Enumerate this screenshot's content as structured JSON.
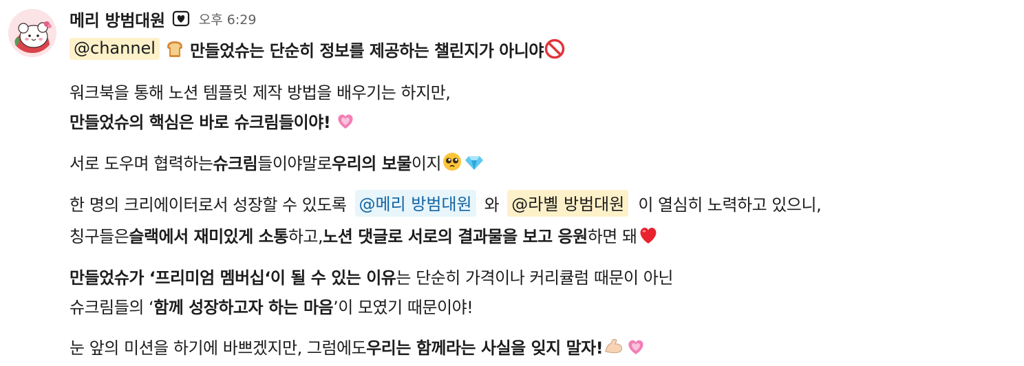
{
  "message": {
    "sender": "메리 방범대원",
    "timestamp": "오후 6:29",
    "status_emoji": "mailbox-heart-emoji",
    "line1": {
      "mention": "@channel",
      "emoji_bread": "bread-emoji",
      "text": "만들었슈는 단순히 정보를 제공하는 챌린지가 아니야",
      "emoji_no": "no-entry-sign-emoji"
    },
    "line2": {
      "text": "워크북을 통해 노션 템플릿 제작 방법을 배우기는 하지만,"
    },
    "line3": {
      "bold": "만들었슈의 핵심은 바로 슈크림들이야!",
      "emoji": "growing-heart-emoji"
    },
    "line4": {
      "t1": "서로 도우며 협력하는 ",
      "b1": "슈크림",
      "t2": "들이야말로 ",
      "b2": "우리의 보물",
      "t3": "이지",
      "emoji1": "pleading-face-emoji",
      "emoji2": "gem-emoji"
    },
    "line5": {
      "t1": "한 명의 크리에이터로서 성장할 수 있도록",
      "mention1": "@메리 방범대원",
      "t2": "와",
      "mention2": "@라볠 방범대원",
      "t3": "이 열심히 노력하고 있으니,"
    },
    "line6": {
      "t1": "칭구들은 ",
      "b1": "슬랙에서 재미있게 소통",
      "t2": "하고, ",
      "b2": "노션 댓글로 서로의 결과물을 보고 응원",
      "t3": "하면 돼",
      "emoji": "red-heart-emoji"
    },
    "line7": {
      "b1": "만들었슈가 ‘프리미엄 멤버십‘이 될 수 있는 이유",
      "t1": "는 단순히 가격이나 커리큘럼 때문이 아닌"
    },
    "line8": {
      "t1": "슈크림들의 ‘",
      "b1": "함께 성장하고자 하는 마음",
      "t2": "’이 모였기 때문이야!"
    },
    "line9": {
      "t1": "눈 앞의 미션을 하기에 바쁘겠지만, 그럼에도 ",
      "b1": "우리는 함께라는 사실을 잊지 말자!",
      "emoji1": "flexed-biceps-emoji",
      "emoji2": "growing-heart-emoji"
    }
  }
}
